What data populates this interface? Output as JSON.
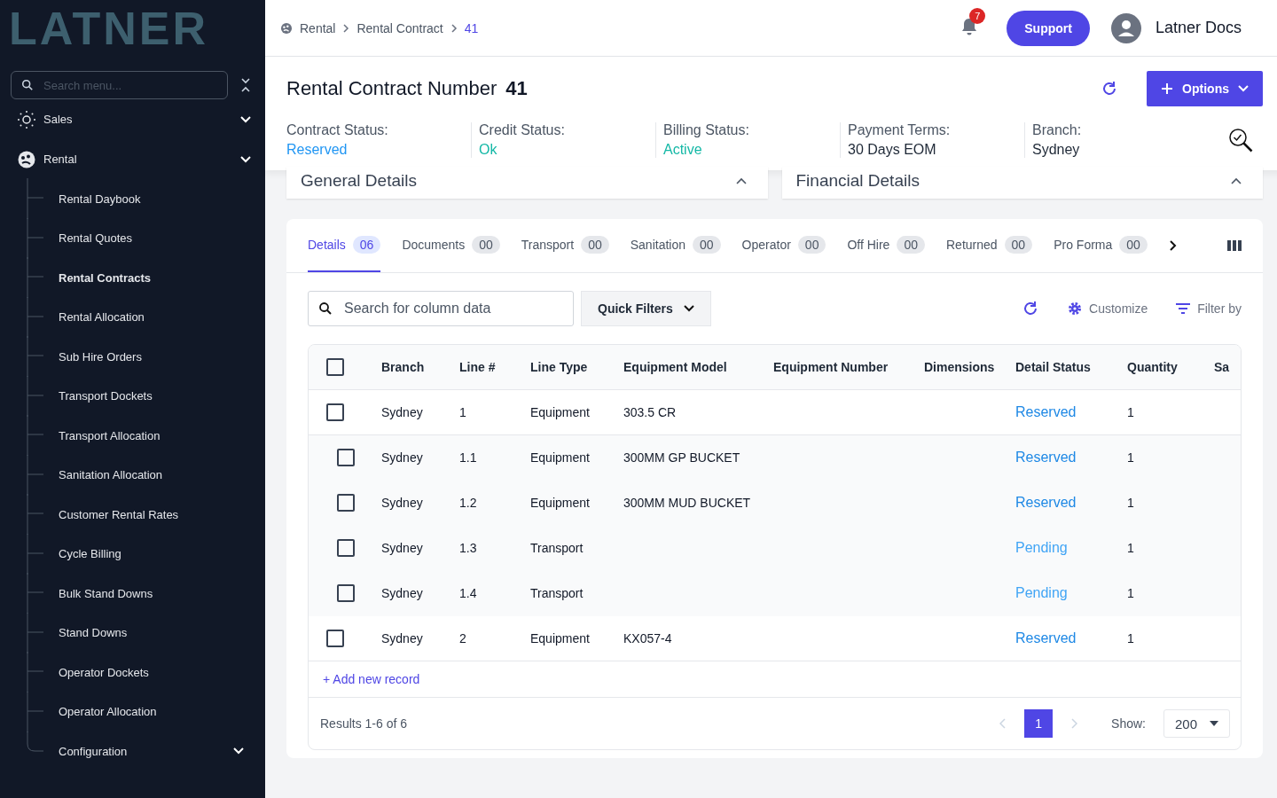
{
  "sidebar": {
    "logo": "LATNER",
    "search": {
      "placeholder": "Search menu..."
    },
    "items": [
      {
        "label": "Sales"
      },
      {
        "label": "Rental",
        "children": [
          {
            "label": "Rental Daybook",
            "kind": "link",
            "selected": false
          },
          {
            "label": "Rental Quotes",
            "kind": "link",
            "selected": false
          },
          {
            "label": "Rental Contracts",
            "kind": "link",
            "selected": true
          },
          {
            "label": "Rental Allocation",
            "kind": "link",
            "selected": false
          },
          {
            "label": "Sub Hire Orders",
            "kind": "link",
            "selected": false
          },
          {
            "label": "Transport Dockets",
            "kind": "link",
            "selected": false
          },
          {
            "label": "Transport Allocation",
            "kind": "link",
            "selected": false
          },
          {
            "label": "Sanitation Allocation",
            "kind": "link",
            "selected": false
          },
          {
            "label": "Customer Rental Rates",
            "kind": "link",
            "selected": false
          },
          {
            "label": "Cycle Billing",
            "kind": "link",
            "selected": false
          },
          {
            "label": "Bulk Stand Downs",
            "kind": "link",
            "selected": false
          },
          {
            "label": "Stand Downs",
            "kind": "link",
            "selected": false
          },
          {
            "label": "Operator Dockets",
            "kind": "link",
            "selected": false
          },
          {
            "label": "Operator Allocation",
            "kind": "link",
            "selected": false
          },
          {
            "label": "Configuration",
            "kind": "group",
            "selected": false
          }
        ]
      }
    ]
  },
  "breadcrumb": [
    "Rental",
    "Rental Contract",
    "41"
  ],
  "topbar": {
    "notifications": "7",
    "support": "Support",
    "user": "Latner Docs"
  },
  "contract": {
    "title": "Rental Contract Number",
    "number": "41",
    "options": "Options",
    "fields": [
      {
        "label": "Contract Status:",
        "value": "Reserved",
        "color": "#2196f3"
      },
      {
        "label": "Credit Status:",
        "value": "Ok",
        "color": "#14b8a6"
      },
      {
        "label": "Billing Status:",
        "value": "Active",
        "color": "#14b8a6"
      },
      {
        "label": "Payment Terms:",
        "value": "30 Days EOM",
        "color": "#1f2937"
      },
      {
        "label": "Branch:",
        "value": "Sydney",
        "color": "#1f2937"
      }
    ]
  },
  "panels": [
    {
      "title": "General Details",
      "expanded": true
    },
    {
      "title": "Financial Details",
      "expanded": true
    }
  ],
  "tabs": [
    {
      "label": "Details",
      "count": "06",
      "selected": true
    },
    {
      "label": "Documents",
      "count": "00",
      "selected": false
    },
    {
      "label": "Transport",
      "count": "00",
      "selected": false
    },
    {
      "label": "Sanitation",
      "count": "00",
      "selected": false
    },
    {
      "label": "Operator",
      "count": "00",
      "selected": false
    },
    {
      "label": "Off Hire",
      "count": "00",
      "selected": false
    },
    {
      "label": "Returned",
      "count": "00",
      "selected": false
    },
    {
      "label": "Pro Forma",
      "count": "00",
      "selected": false
    }
  ],
  "toolbar": {
    "search": {
      "placeholder": "Search for column data"
    },
    "quick_filters": "Quick Filters",
    "customize": "Customize",
    "filter_by": "Filter by"
  },
  "table": {
    "select_all_checked": false,
    "columns": [
      "Branch",
      "Line #",
      "Line Type",
      "Equipment Model",
      "Equipment Number",
      "Dimensions",
      "Detail Status",
      "Quantity",
      "Sa"
    ],
    "rows": [
      {
        "kind": "parent",
        "checked": false,
        "cells": [
          "Sydney",
          "1",
          "Equipment",
          "303.5 CR",
          "",
          "",
          "Reserved",
          "1",
          ""
        ],
        "color": "#1e88e5"
      },
      {
        "kind": "child",
        "checked": false,
        "cells": [
          "Sydney",
          "1.1",
          "Equipment",
          "300MM GP BUCKET",
          "",
          "",
          "Reserved",
          "1",
          ""
        ],
        "color": "#1e88e5"
      },
      {
        "kind": "child",
        "checked": false,
        "cells": [
          "Sydney",
          "1.2",
          "Equipment",
          "300MM MUD BUCKET",
          "",
          "",
          "Reserved",
          "1",
          ""
        ],
        "color": "#1e88e5"
      },
      {
        "kind": "child",
        "checked": false,
        "cells": [
          "Sydney",
          "1.3",
          "Transport",
          "",
          "",
          "",
          "Pending",
          "1",
          ""
        ],
        "color": "#42a5f5"
      },
      {
        "kind": "child",
        "checked": false,
        "cells": [
          "Sydney",
          "1.4",
          "Transport",
          "",
          "",
          "",
          "Pending",
          "1",
          ""
        ],
        "color": "#42a5f5"
      },
      {
        "kind": "parent",
        "checked": false,
        "cells": [
          "Sydney",
          "2",
          "Equipment",
          "KX057-4",
          "",
          "",
          "Reserved",
          "1",
          ""
        ],
        "color": "#1e88e5"
      }
    ],
    "add_record": "+ Add new record",
    "results": "Results 1-6 of 6",
    "page": "1",
    "show_label": "Show:",
    "page_size": "200"
  }
}
